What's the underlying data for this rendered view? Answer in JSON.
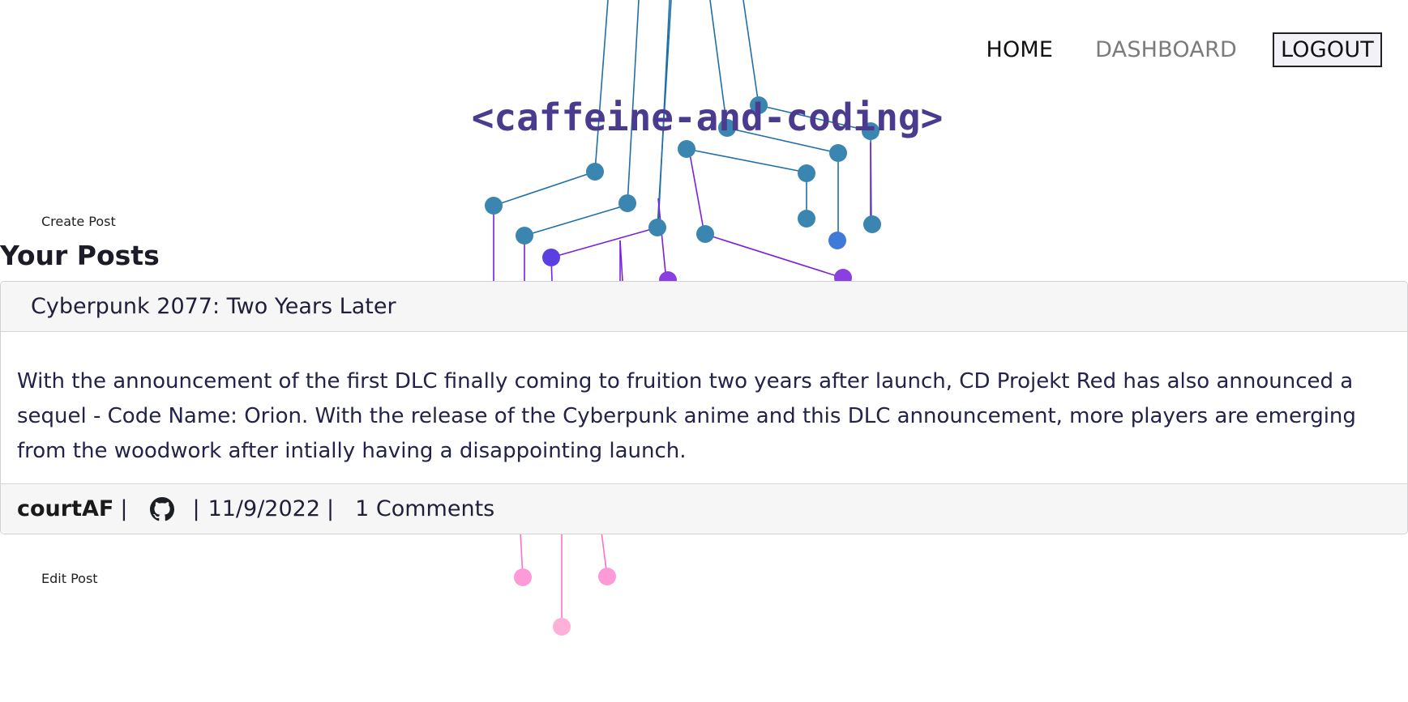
{
  "nav": {
    "home_label": "HOME",
    "dashboard_label": "DASHBOARD",
    "logout_label": "LOGOUT"
  },
  "site": {
    "title": "<caffeine-and-coding>"
  },
  "actions": {
    "create_post_label": "Create Post",
    "edit_post_label": "Edit Post"
  },
  "section": {
    "heading": "Your Posts"
  },
  "post": {
    "title": "Cyberpunk 2077: Two Years Later",
    "body": "With the announcement of the first DLC finally coming to fruition two years after launch, CD Projekt Red has also announced a sequel - Code Name: Orion. With the release of the Cyberpunk anime and this DLC announcement, more players are emerging from the woodwork after intially having a disappointing launch.",
    "author": "courtAF",
    "date": "11/9/2022",
    "comments": "1 Comments"
  },
  "icons": {
    "author_link": "github-icon"
  },
  "colors": {
    "title": "#4b3b8f",
    "node_teal": "#3a86b0",
    "line_purple": "#9a16e8",
    "line_pink": "#ff7fd0"
  }
}
